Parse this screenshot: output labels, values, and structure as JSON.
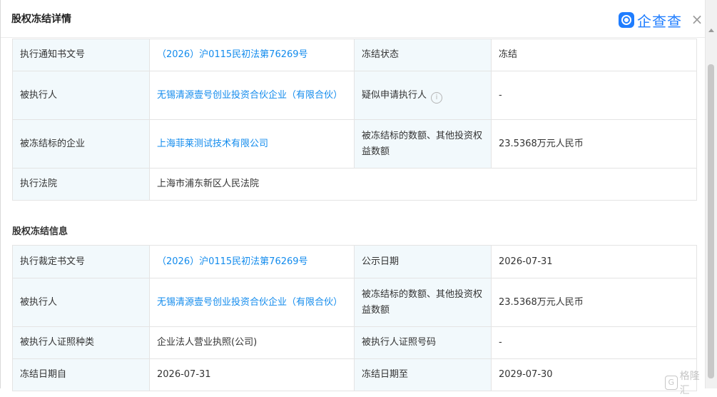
{
  "header": {
    "title": "股权冻结详情",
    "logo_text": "企查查",
    "close_label": "×"
  },
  "detail_section": {
    "rows": [
      {
        "l1": "执行通知书文号",
        "v1": "（2026）沪0115民初法第76269号",
        "l2": "冻结状态",
        "v2": "冻结"
      },
      {
        "l1": "被执行人",
        "v1": "无锡清源壹号创业投资合伙企业（有限合伙）",
        "l2": "疑似申请执行人",
        "v2": "-"
      },
      {
        "l1": "被冻结标的企业",
        "v1": "上海菲莱测试技术有限公司",
        "l2": "被冻结标的数额、其他投资权益数额",
        "v2": "23.5368万元人民币"
      },
      {
        "l1": "执行法院",
        "v1": "上海市浦东新区人民法院"
      }
    ]
  },
  "freeze_info": {
    "title": "股权冻结信息",
    "rows": [
      {
        "l1": "执行裁定书文号",
        "v1": "（2026）沪0115民初法第76269号",
        "l2": "公示日期",
        "v2": "2026-07-31"
      },
      {
        "l1": "被执行人",
        "v1": "无锡清源壹号创业投资合伙企业（有限合伙）",
        "l2": "被冻结标的数额、其他投资权益数额",
        "v2": "23.5368万元人民币"
      },
      {
        "l1": "被执行人证照种类",
        "v1": "企业法人营业执照(公司)",
        "l2": "被执行人证照号码",
        "v2": "-"
      },
      {
        "l1": "冻结日期自",
        "v1": "2026-07-31",
        "l2": "冻结日期至",
        "v2": "2029-07-30"
      }
    ]
  },
  "watermark": {
    "text": "格隆汇"
  },
  "colors": {
    "link": "#128bed",
    "label_bg": "#f2f9fc",
    "border": "#e4e4e4",
    "brand": "#1f7dff"
  }
}
